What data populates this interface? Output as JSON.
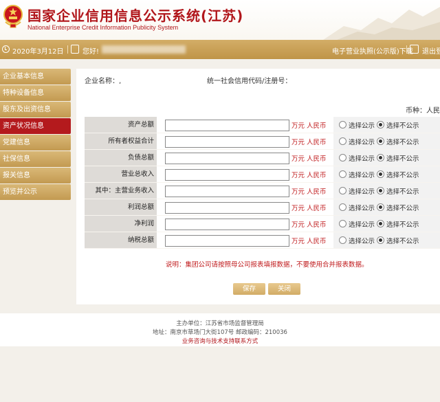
{
  "header": {
    "title_cn": "国家企业信用信息公示系统(江苏)",
    "title_en": "National Enterprise Credit Information Publicity System"
  },
  "topbar": {
    "date": "2020年3月12日",
    "greeting": "您好!",
    "license_link": "电子营业执照(公示版)下载",
    "logout": "退出登"
  },
  "sidebar": {
    "items": [
      {
        "label": "企业基本信息",
        "active": false
      },
      {
        "label": "特种设备信息",
        "active": false
      },
      {
        "label": "股东及出资信息",
        "active": false
      },
      {
        "label": "资产状况信息",
        "active": true
      },
      {
        "label": "党建信息",
        "active": false
      },
      {
        "label": "社保信息",
        "active": false
      },
      {
        "label": "报关信息",
        "active": false
      },
      {
        "label": "预览并公示",
        "active": false
      }
    ]
  },
  "main": {
    "company_label": "企业名称：,",
    "code_label": "统一社会信用代码/注册号：",
    "currency_label": "币种：人民",
    "rows": [
      {
        "label": "资产总额",
        "value": "",
        "unit": "万元 人民币",
        "option_public": "选择公示",
        "option_private": "选择不公示",
        "selected": "private"
      },
      {
        "label": "所有者权益合计",
        "value": "",
        "unit": "万元 人民币",
        "option_public": "选择公示",
        "option_private": "选择不公示",
        "selected": "private"
      },
      {
        "label": "负债总额",
        "value": "",
        "unit": "万元 人民币",
        "option_public": "选择公示",
        "option_private": "选择不公示",
        "selected": "private"
      },
      {
        "label": "营业总收入",
        "value": "",
        "unit": "万元 人民币",
        "option_public": "选择公示",
        "option_private": "选择不公示",
        "selected": "private"
      },
      {
        "label": "其中：主营业务收入",
        "value": "",
        "unit": "万元 人民币",
        "option_public": "选择公示",
        "option_private": "选择不公示",
        "selected": "private"
      },
      {
        "label": "利润总额",
        "value": "",
        "unit": "万元 人民币",
        "option_public": "选择公示",
        "option_private": "选择不公示",
        "selected": "private"
      },
      {
        "label": "净利润",
        "value": "",
        "unit": "万元 人民币",
        "option_public": "选择公示",
        "option_private": "选择不公示",
        "selected": "private"
      },
      {
        "label": "纳税总额",
        "value": "",
        "unit": "万元 人民币",
        "option_public": "选择公示",
        "option_private": "选择不公示",
        "selected": "private"
      }
    ],
    "note": "说明：集团公司请按照母公司报表填报数据，不要使用合并报表数据。",
    "save_button": "保存",
    "close_button": "关闭"
  },
  "footer": {
    "host": "主办单位：江苏省市场监督管理局",
    "address": "地址：南京市草场门大街107号    邮政编码：210036",
    "support_link": "业务咨询与技术支持联系方式"
  },
  "colors": {
    "brand_red": "#b1161b",
    "gold": "#c9a059"
  }
}
